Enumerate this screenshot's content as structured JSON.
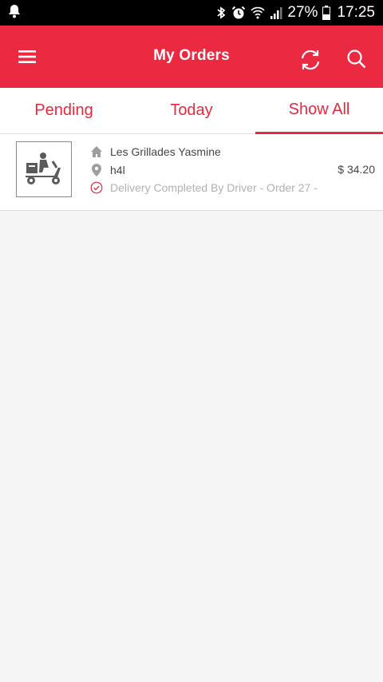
{
  "status_bar": {
    "battery": "27%",
    "time": "17:25"
  },
  "header": {
    "title": "My Orders"
  },
  "tabs": [
    {
      "label": "Pending",
      "active": false
    },
    {
      "label": "Today",
      "active": false
    },
    {
      "label": "Show All",
      "active": true
    }
  ],
  "orders": [
    {
      "restaurant": "Les Grillades Yasmine",
      "location": "h4l",
      "status": "Delivery Completed By Driver - Order 27 -",
      "price": "$ 34.20"
    }
  ],
  "colors": {
    "accent": "#eb2a42",
    "tab_text": "#e8283f",
    "status_bar": "#000000",
    "background": "#f5f5f5"
  }
}
